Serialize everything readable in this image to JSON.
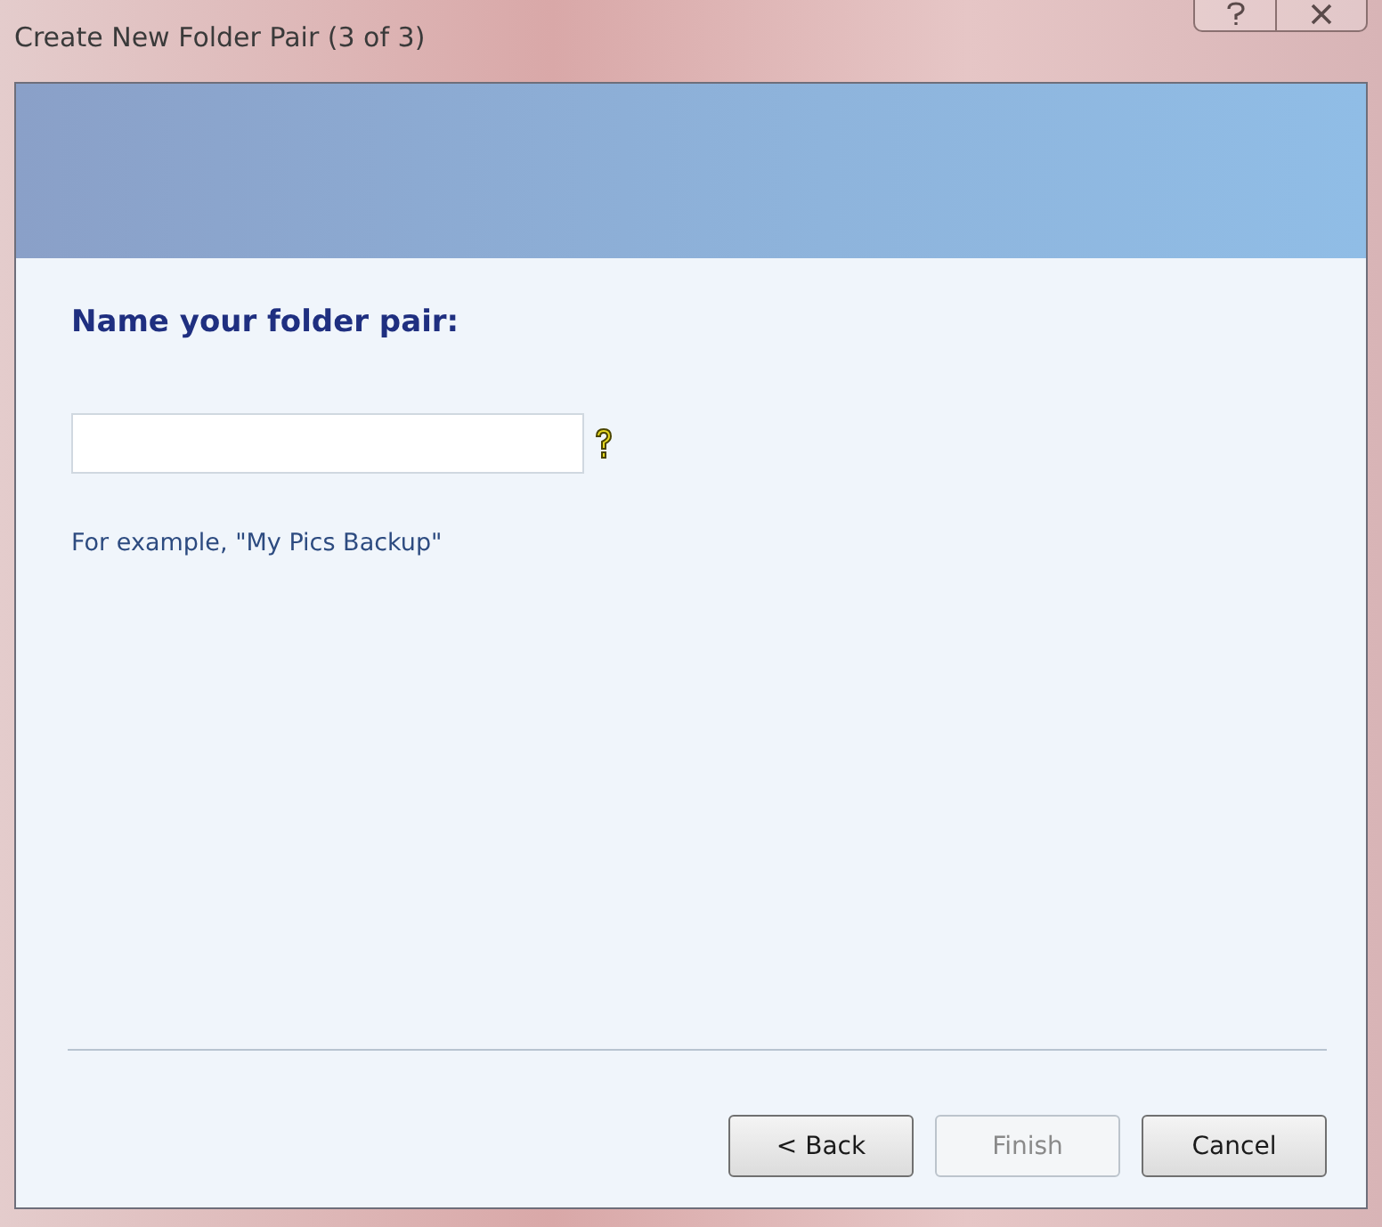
{
  "window": {
    "title": "Create New Folder Pair (3 of 3)"
  },
  "heading": "Name your folder pair:",
  "hint": "For example, \"My Pics Backup\"",
  "buttons": [
    {
      "label": "< Back",
      "disabled": false
    },
    {
      "label": "Finish",
      "disabled": true
    },
    {
      "label": "Cancel",
      "disabled": false
    }
  ]
}
